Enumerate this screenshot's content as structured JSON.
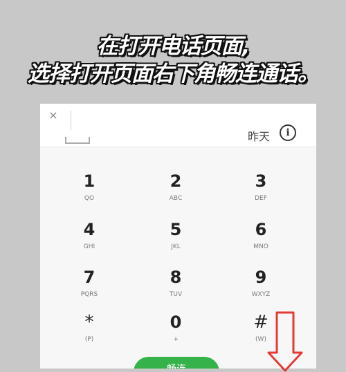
{
  "caption": {
    "line1": "在打开电话页面,",
    "line2": "选择打开页面右下角畅连通话。"
  },
  "topbar": {
    "close_glyph": "×",
    "recent_label": "昨天",
    "info_glyph": "i"
  },
  "keypad": [
    {
      "num": "1",
      "sub": "QO"
    },
    {
      "num": "2",
      "sub": "ABC"
    },
    {
      "num": "3",
      "sub": "DEF"
    },
    {
      "num": "4",
      "sub": "GHI"
    },
    {
      "num": "5",
      "sub": "JKL"
    },
    {
      "num": "6",
      "sub": "MNO"
    },
    {
      "num": "7",
      "sub": "PQRS"
    },
    {
      "num": "8",
      "sub": "TUV"
    },
    {
      "num": "9",
      "sub": "WXYZ"
    },
    {
      "num": "*",
      "sub": "(P)"
    },
    {
      "num": "0",
      "sub": "+"
    },
    {
      "num": "#",
      "sub": "(W)"
    }
  ],
  "bottom": {
    "menu_glyph": "...",
    "call_label": "畅连"
  },
  "colors": {
    "background": "#c8c8c8",
    "call_button": "#36b24a",
    "arrow": "#e53935"
  }
}
